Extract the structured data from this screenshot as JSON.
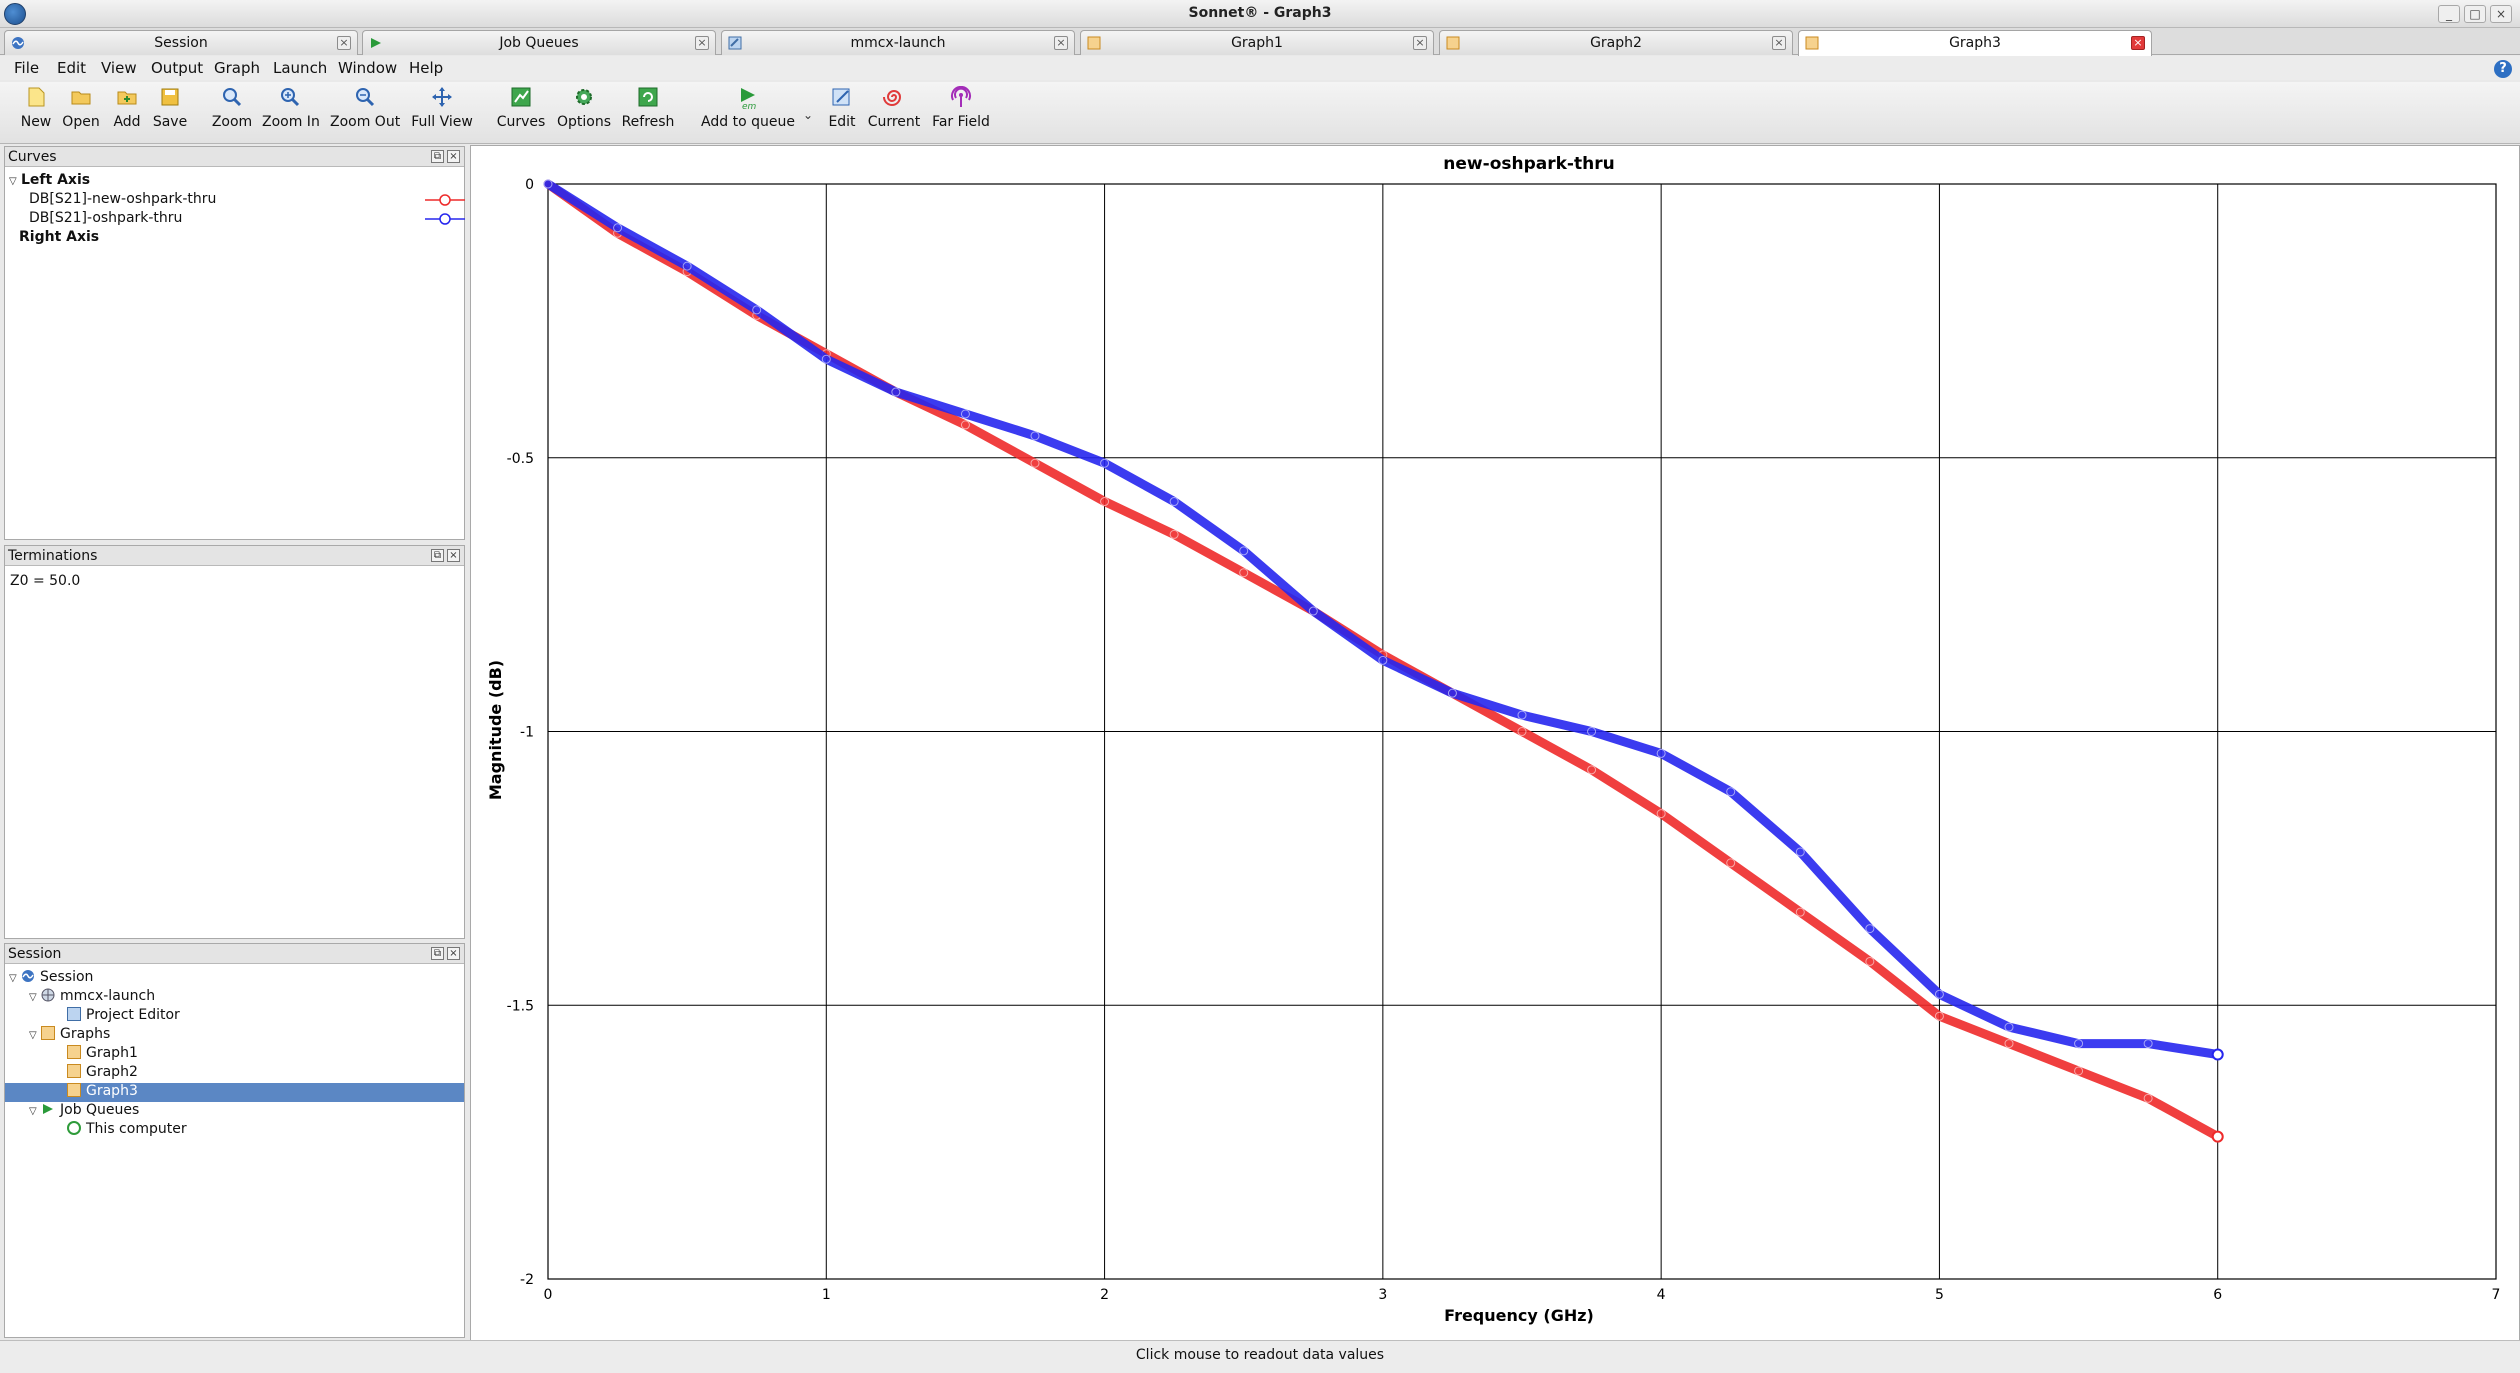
{
  "window": {
    "title": "Sonnet® - Graph3"
  },
  "tabs": [
    {
      "label": "Session",
      "icon": "session-icon"
    },
    {
      "label": "Job Queues",
      "icon": "job-queue-icon"
    },
    {
      "label": "mmcx-launch",
      "icon": "project-icon"
    },
    {
      "label": "Graph1",
      "icon": "graph-icon"
    },
    {
      "label": "Graph2",
      "icon": "graph-icon"
    },
    {
      "label": "Graph3",
      "icon": "graph-icon",
      "active": true
    }
  ],
  "menu": [
    "File",
    "Edit",
    "View",
    "Output",
    "Graph",
    "Launch",
    "Window",
    "Help"
  ],
  "toolbar": {
    "new": "New",
    "open": "Open",
    "add": "Add",
    "save": "Save",
    "zoom": "Zoom",
    "zoom_in": "Zoom In",
    "zoom_out": "Zoom Out",
    "full_view": "Full View",
    "curves": "Curves",
    "options": "Options",
    "refresh": "Refresh",
    "add_to_queue": "Add to queue",
    "em_badge": "em",
    "edit": "Edit",
    "current": "Current",
    "far_field": "Far Field"
  },
  "curves_panel": {
    "title": "Curves",
    "left_axis": "Left Axis",
    "right_axis": "Right Axis",
    "items": [
      {
        "label": "DB[S21]-new-oshpark-thru",
        "color": "#ee2a2a"
      },
      {
        "label": "DB[S21]-oshpark-thru",
        "color": "#2626ee"
      }
    ]
  },
  "terminations_panel": {
    "title": "Terminations",
    "text": "Z0 = 50.0"
  },
  "session_panel": {
    "title": "Session",
    "root": "Session",
    "project": "mmcx-launch",
    "project_editor": "Project Editor",
    "graphs": "Graphs",
    "graph_items": [
      "Graph1",
      "Graph2",
      "Graph3"
    ],
    "job_queues": "Job Queues",
    "this_computer": "This computer"
  },
  "status": {
    "text": "Click mouse to readout data values"
  },
  "chart_data": {
    "type": "line",
    "title": "new-oshpark-thru",
    "xlabel": "Frequency (GHz)",
    "ylabel": "Magnitude (dB)",
    "xlim": [
      0,
      7
    ],
    "ylim": [
      -2,
      0
    ],
    "xticks": [
      0,
      1,
      2,
      3,
      4,
      5,
      6,
      7
    ],
    "yticks": [
      0,
      -0.5,
      -1,
      -1.5,
      -2
    ],
    "grid": true,
    "series": [
      {
        "name": "DB[S21]-new-oshpark-thru",
        "color": "#ee2a2a",
        "x": [
          0,
          0.25,
          0.5,
          0.75,
          1.0,
          1.25,
          1.5,
          1.75,
          2.0,
          2.25,
          2.5,
          2.75,
          3.0,
          3.25,
          3.5,
          3.75,
          4.0,
          4.25,
          4.5,
          4.75,
          5.0,
          5.25,
          5.5,
          5.75,
          6.0
        ],
        "y": [
          0,
          -0.09,
          -0.16,
          -0.24,
          -0.31,
          -0.38,
          -0.44,
          -0.51,
          -0.58,
          -0.64,
          -0.71,
          -0.78,
          -0.86,
          -0.93,
          -1.0,
          -1.07,
          -1.15,
          -1.24,
          -1.33,
          -1.42,
          -1.52,
          -1.57,
          -1.62,
          -1.67,
          -1.74
        ]
      },
      {
        "name": "DB[S21]-oshpark-thru",
        "color": "#2626ee",
        "x": [
          0,
          0.25,
          0.5,
          0.75,
          1.0,
          1.25,
          1.5,
          1.75,
          2.0,
          2.25,
          2.5,
          2.75,
          3.0,
          3.25,
          3.5,
          3.75,
          4.0,
          4.25,
          4.5,
          4.75,
          5.0,
          5.25,
          5.5,
          5.75,
          6.0
        ],
        "y": [
          0,
          -0.08,
          -0.15,
          -0.23,
          -0.32,
          -0.38,
          -0.42,
          -0.46,
          -0.51,
          -0.58,
          -0.67,
          -0.78,
          -0.87,
          -0.93,
          -0.97,
          -1.0,
          -1.04,
          -1.11,
          -1.22,
          -1.36,
          -1.48,
          -1.54,
          -1.57,
          -1.57,
          -1.59
        ]
      }
    ]
  }
}
